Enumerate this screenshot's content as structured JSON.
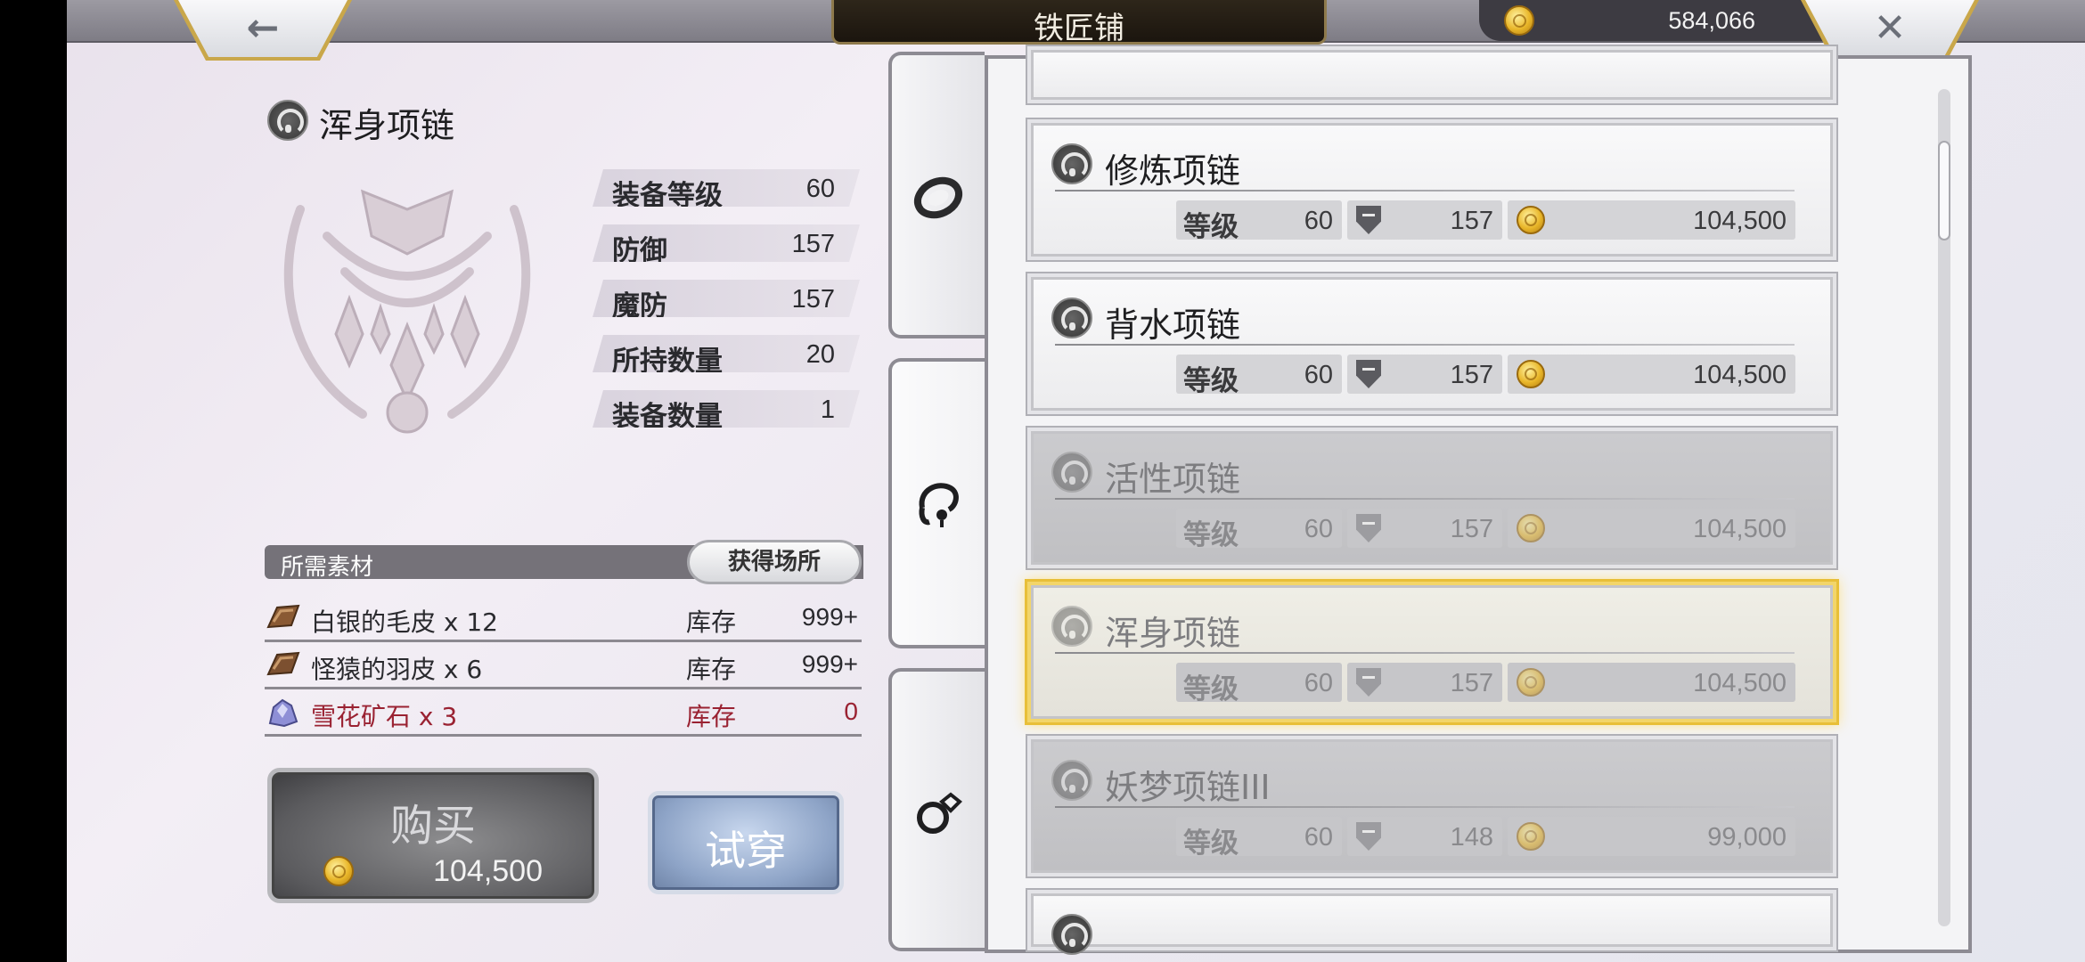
{
  "header": {
    "back_glyph": "←",
    "title": "铁匠铺",
    "gold": "584,066",
    "close_glyph": "✕"
  },
  "item": {
    "name": "浑身项链",
    "stats": [
      {
        "label": "装备等级",
        "value": "60"
      },
      {
        "label": "防御",
        "value": "157"
      },
      {
        "label": "魔防",
        "value": "157"
      },
      {
        "label": "所持数量",
        "value": "20"
      },
      {
        "label": "装备数量",
        "value": "1"
      }
    ]
  },
  "materials": {
    "header": "所需素材",
    "source_button": "获得场所",
    "rows": [
      {
        "name": "白银的毛皮 x 12",
        "stock_label": "库存",
        "count": "999+",
        "icon": "fur-icon"
      },
      {
        "name": "怪猿的羽皮 x 6",
        "stock_label": "库存",
        "count": "999+",
        "icon": "fur-icon"
      },
      {
        "name": "雪花矿石 x 3",
        "stock_label": "库存",
        "count": "0",
        "icon": "ore-icon",
        "color": "#9a2232"
      }
    ]
  },
  "actions": {
    "buy_label": "购买",
    "buy_price": "104,500",
    "try_label": "试穿"
  },
  "tabs": [
    {
      "icon": "bracelet-icon"
    },
    {
      "icon": "necklace-icon",
      "active": true
    },
    {
      "icon": "ring-icon"
    }
  ],
  "list": {
    "level_label": "等级",
    "items": [
      {
        "name": "修炼项链",
        "level": "60",
        "defense": "157",
        "price": "104,500",
        "state": "normal"
      },
      {
        "name": "背水项链",
        "level": "60",
        "defense": "157",
        "price": "104,500",
        "state": "normal"
      },
      {
        "name": "活性项链",
        "level": "60",
        "defense": "157",
        "price": "104,500",
        "state": "dim"
      },
      {
        "name": "浑身项链",
        "level": "60",
        "defense": "157",
        "price": "104,500",
        "state": "selected"
      },
      {
        "name": "妖梦项链III",
        "level": "60",
        "defense": "148",
        "price": "99,000",
        "state": "dim"
      },
      {
        "name": "",
        "state": "normal"
      }
    ]
  },
  "colors": {
    "selected_glow": "#e8bf38",
    "missing_material": "#9a2232",
    "title_plate": "#1b150e"
  }
}
